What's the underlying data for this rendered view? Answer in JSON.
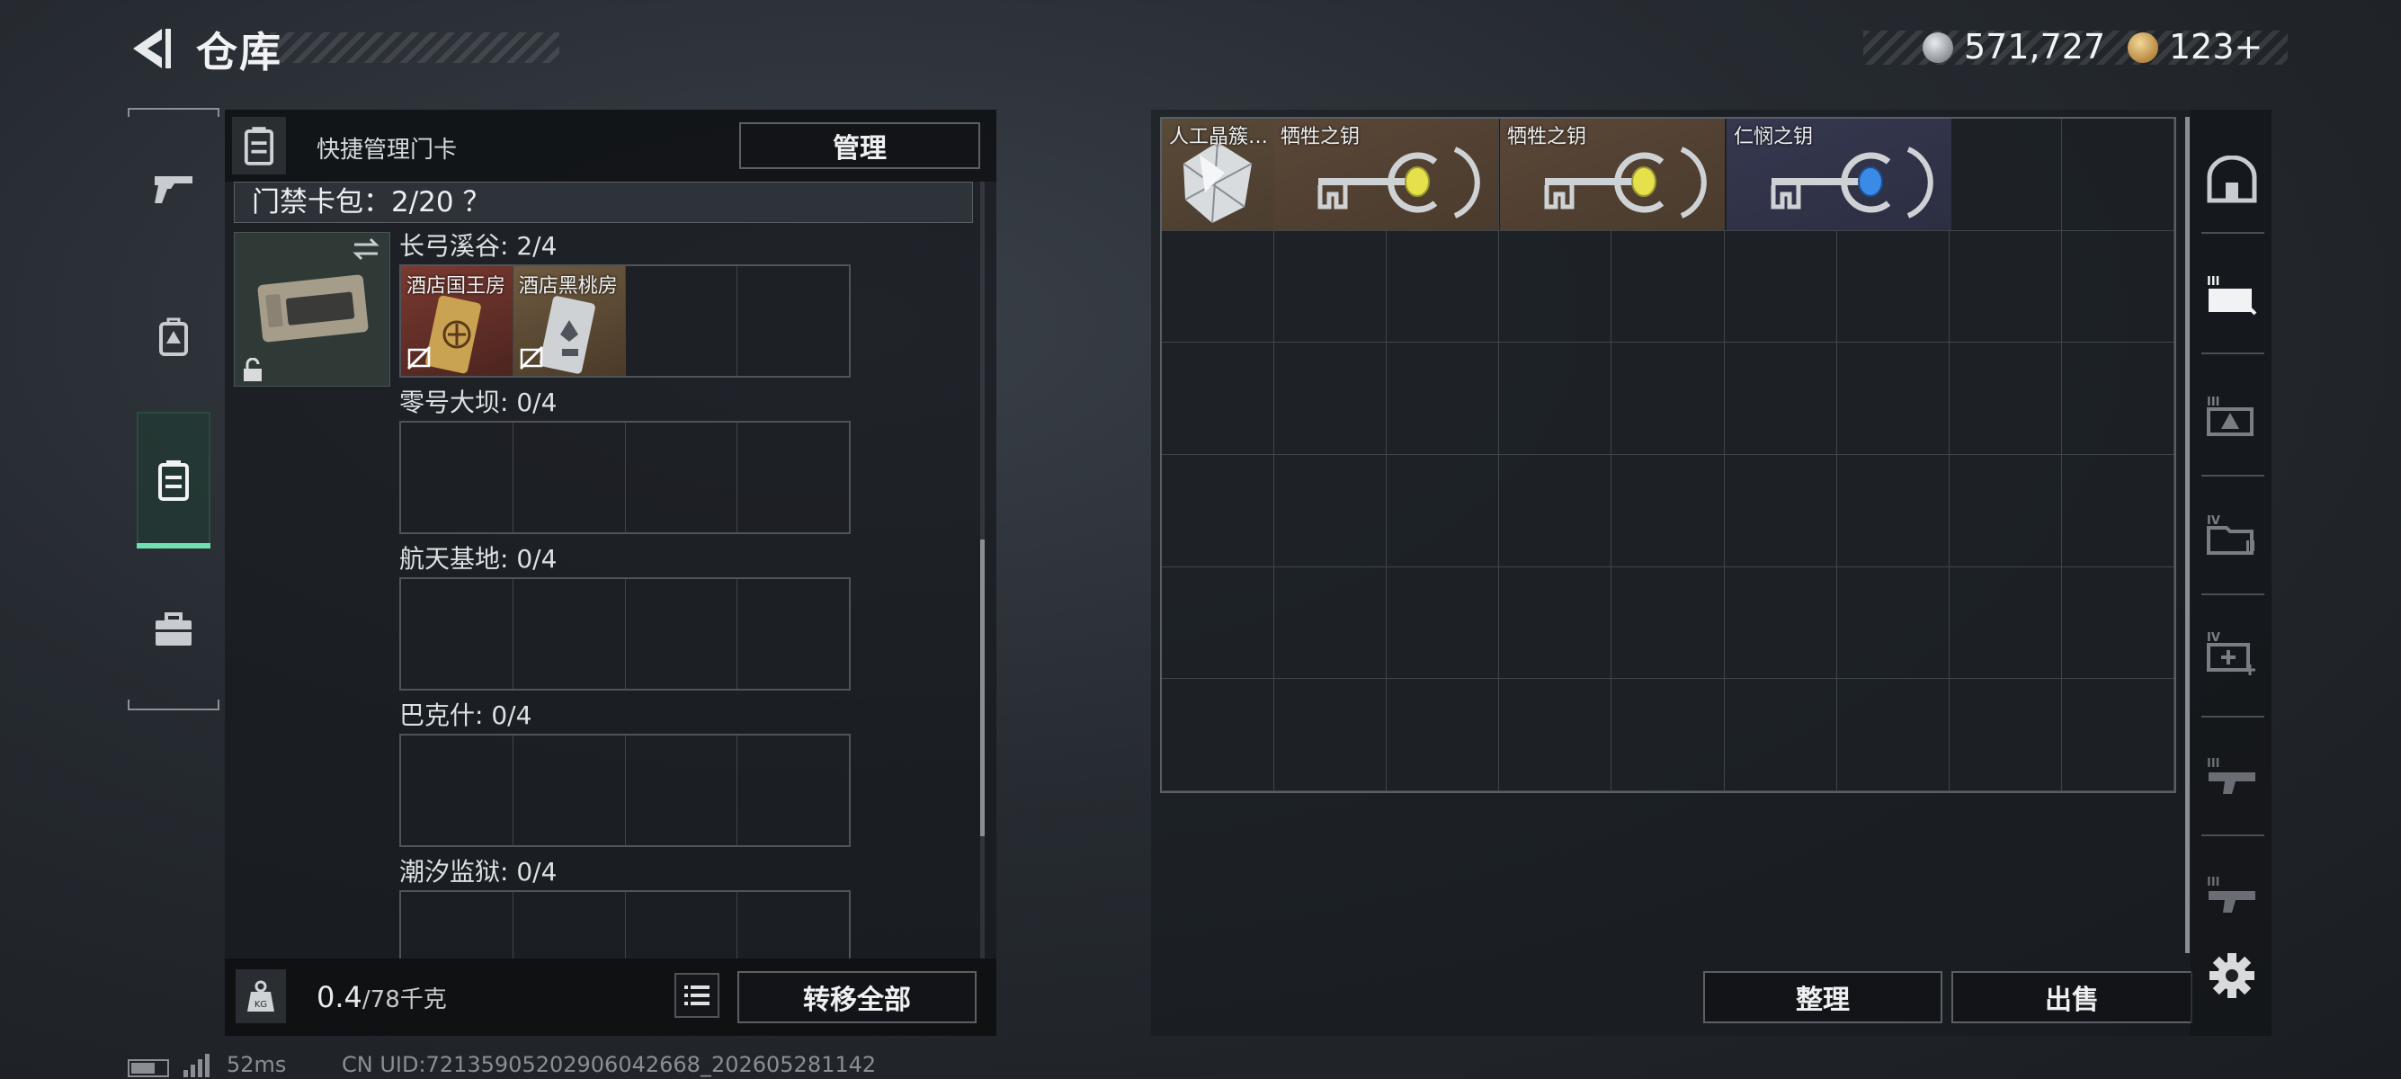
{
  "header": {
    "title": "仓库",
    "currency_primary": "571,727",
    "currency_secondary": "123+",
    "currency_primary_icon": "silver-coin-icon",
    "currency_secondary_icon": "gold-coin-icon"
  },
  "left_nav": {
    "items": [
      {
        "icon": "pistol-icon",
        "active": false
      },
      {
        "icon": "backpack-icon",
        "active": false
      },
      {
        "icon": "card-holder-icon",
        "active": true
      },
      {
        "icon": "toolbox-icon",
        "active": false
      }
    ],
    "accent": "#6fe0b0"
  },
  "left_panel": {
    "header_label": "快捷管理门卡",
    "manage_label": "管理",
    "cardpack_label": "门禁卡包：2/20 ？",
    "sections": [
      {
        "label": "长弓溪谷: 2/4",
        "items": [
          {
            "name": "酒店国王房",
            "color": "#6b3a2c"
          },
          {
            "name": "酒店黑桃房",
            "color": "#6a5238"
          }
        ]
      },
      {
        "label": "零号大坝: 0/4",
        "items": []
      },
      {
        "label": "航天基地: 0/4",
        "items": []
      },
      {
        "label": "巴克什: 0/4",
        "items": []
      },
      {
        "label": "潮汐监狱: 0/4",
        "items": []
      }
    ],
    "weight_value": "0.4",
    "weight_capacity": "/78千克",
    "transfer_all_label": "转移全部"
  },
  "right_panel": {
    "items": [
      {
        "name": "人工晶簇…"
      },
      {
        "name": "牺牲之钥",
        "gem": "#e6e04a"
      },
      {
        "name": "牺牲之钥",
        "gem": "#e6e04a"
      },
      {
        "name": "仁悯之钥",
        "gem": "#3a8ae8"
      }
    ],
    "sort_label": "整理",
    "sell_label": "出售"
  },
  "status_bar": {
    "ping": "52ms",
    "uid": "CN UID:7213590520290604266​8_202605281142"
  }
}
